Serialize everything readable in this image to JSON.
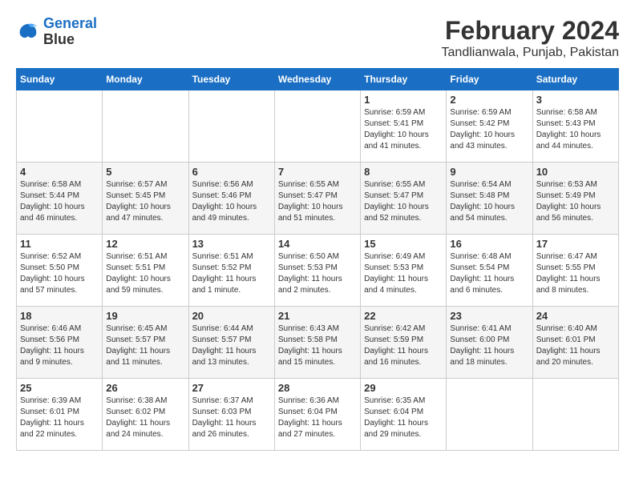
{
  "header": {
    "logo_line1": "General",
    "logo_line2": "Blue",
    "month_year": "February 2024",
    "location": "Tandlianwala, Punjab, Pakistan"
  },
  "days_of_week": [
    "Sunday",
    "Monday",
    "Tuesday",
    "Wednesday",
    "Thursday",
    "Friday",
    "Saturday"
  ],
  "weeks": [
    [
      {
        "day": "",
        "detail": ""
      },
      {
        "day": "",
        "detail": ""
      },
      {
        "day": "",
        "detail": ""
      },
      {
        "day": "",
        "detail": ""
      },
      {
        "day": "1",
        "detail": "Sunrise: 6:59 AM\nSunset: 5:41 PM\nDaylight: 10 hours\nand 41 minutes."
      },
      {
        "day": "2",
        "detail": "Sunrise: 6:59 AM\nSunset: 5:42 PM\nDaylight: 10 hours\nand 43 minutes."
      },
      {
        "day": "3",
        "detail": "Sunrise: 6:58 AM\nSunset: 5:43 PM\nDaylight: 10 hours\nand 44 minutes."
      }
    ],
    [
      {
        "day": "4",
        "detail": "Sunrise: 6:58 AM\nSunset: 5:44 PM\nDaylight: 10 hours\nand 46 minutes."
      },
      {
        "day": "5",
        "detail": "Sunrise: 6:57 AM\nSunset: 5:45 PM\nDaylight: 10 hours\nand 47 minutes."
      },
      {
        "day": "6",
        "detail": "Sunrise: 6:56 AM\nSunset: 5:46 PM\nDaylight: 10 hours\nand 49 minutes."
      },
      {
        "day": "7",
        "detail": "Sunrise: 6:55 AM\nSunset: 5:47 PM\nDaylight: 10 hours\nand 51 minutes."
      },
      {
        "day": "8",
        "detail": "Sunrise: 6:55 AM\nSunset: 5:47 PM\nDaylight: 10 hours\nand 52 minutes."
      },
      {
        "day": "9",
        "detail": "Sunrise: 6:54 AM\nSunset: 5:48 PM\nDaylight: 10 hours\nand 54 minutes."
      },
      {
        "day": "10",
        "detail": "Sunrise: 6:53 AM\nSunset: 5:49 PM\nDaylight: 10 hours\nand 56 minutes."
      }
    ],
    [
      {
        "day": "11",
        "detail": "Sunrise: 6:52 AM\nSunset: 5:50 PM\nDaylight: 10 hours\nand 57 minutes."
      },
      {
        "day": "12",
        "detail": "Sunrise: 6:51 AM\nSunset: 5:51 PM\nDaylight: 10 hours\nand 59 minutes."
      },
      {
        "day": "13",
        "detail": "Sunrise: 6:51 AM\nSunset: 5:52 PM\nDaylight: 11 hours\nand 1 minute."
      },
      {
        "day": "14",
        "detail": "Sunrise: 6:50 AM\nSunset: 5:53 PM\nDaylight: 11 hours\nand 2 minutes."
      },
      {
        "day": "15",
        "detail": "Sunrise: 6:49 AM\nSunset: 5:53 PM\nDaylight: 11 hours\nand 4 minutes."
      },
      {
        "day": "16",
        "detail": "Sunrise: 6:48 AM\nSunset: 5:54 PM\nDaylight: 11 hours\nand 6 minutes."
      },
      {
        "day": "17",
        "detail": "Sunrise: 6:47 AM\nSunset: 5:55 PM\nDaylight: 11 hours\nand 8 minutes."
      }
    ],
    [
      {
        "day": "18",
        "detail": "Sunrise: 6:46 AM\nSunset: 5:56 PM\nDaylight: 11 hours\nand 9 minutes."
      },
      {
        "day": "19",
        "detail": "Sunrise: 6:45 AM\nSunset: 5:57 PM\nDaylight: 11 hours\nand 11 minutes."
      },
      {
        "day": "20",
        "detail": "Sunrise: 6:44 AM\nSunset: 5:57 PM\nDaylight: 11 hours\nand 13 minutes."
      },
      {
        "day": "21",
        "detail": "Sunrise: 6:43 AM\nSunset: 5:58 PM\nDaylight: 11 hours\nand 15 minutes."
      },
      {
        "day": "22",
        "detail": "Sunrise: 6:42 AM\nSunset: 5:59 PM\nDaylight: 11 hours\nand 16 minutes."
      },
      {
        "day": "23",
        "detail": "Sunrise: 6:41 AM\nSunset: 6:00 PM\nDaylight: 11 hours\nand 18 minutes."
      },
      {
        "day": "24",
        "detail": "Sunrise: 6:40 AM\nSunset: 6:01 PM\nDaylight: 11 hours\nand 20 minutes."
      }
    ],
    [
      {
        "day": "25",
        "detail": "Sunrise: 6:39 AM\nSunset: 6:01 PM\nDaylight: 11 hours\nand 22 minutes."
      },
      {
        "day": "26",
        "detail": "Sunrise: 6:38 AM\nSunset: 6:02 PM\nDaylight: 11 hours\nand 24 minutes."
      },
      {
        "day": "27",
        "detail": "Sunrise: 6:37 AM\nSunset: 6:03 PM\nDaylight: 11 hours\nand 26 minutes."
      },
      {
        "day": "28",
        "detail": "Sunrise: 6:36 AM\nSunset: 6:04 PM\nDaylight: 11 hours\nand 27 minutes."
      },
      {
        "day": "29",
        "detail": "Sunrise: 6:35 AM\nSunset: 6:04 PM\nDaylight: 11 hours\nand 29 minutes."
      },
      {
        "day": "",
        "detail": ""
      },
      {
        "day": "",
        "detail": ""
      }
    ]
  ]
}
